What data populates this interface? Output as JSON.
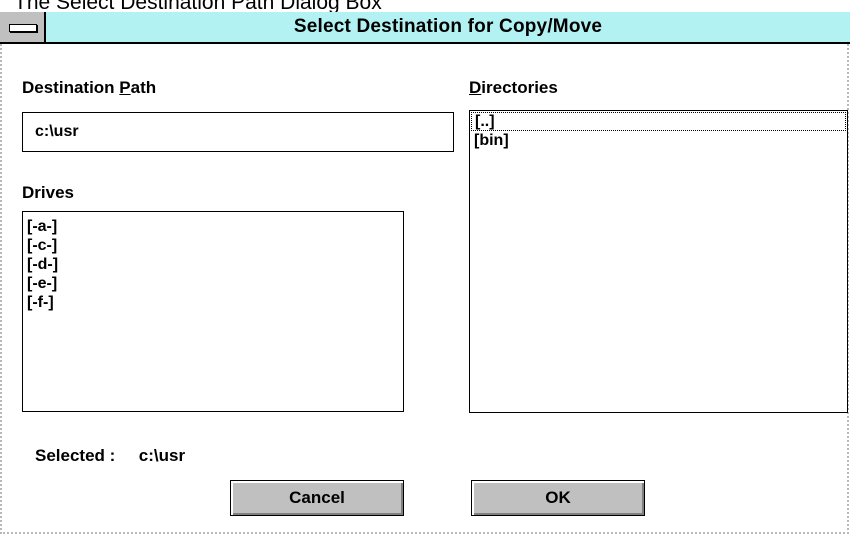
{
  "caption": "The Select Destination Path Dialog Box",
  "window": {
    "title": "Select Destination for Copy/Move"
  },
  "destination_path": {
    "label_pre": "Destination ",
    "label_accel": "P",
    "label_post": "ath",
    "value": "c:\\usr"
  },
  "drives": {
    "label": "Drives",
    "items": [
      "[-a-]",
      "[-c-]",
      "[-d-]",
      "[-e-]",
      "[-f-]"
    ]
  },
  "directories": {
    "label_accel": "D",
    "label_post": "irectories",
    "items": [
      "[..]",
      "[bin]"
    ],
    "focused_index": 0
  },
  "selected": {
    "label": "Selected :",
    "value": "c:\\usr"
  },
  "buttons": {
    "cancel": "Cancel",
    "ok": "OK"
  },
  "colors": {
    "titlebar": "#b2f2f2",
    "button_face": "#c0c0c0"
  }
}
